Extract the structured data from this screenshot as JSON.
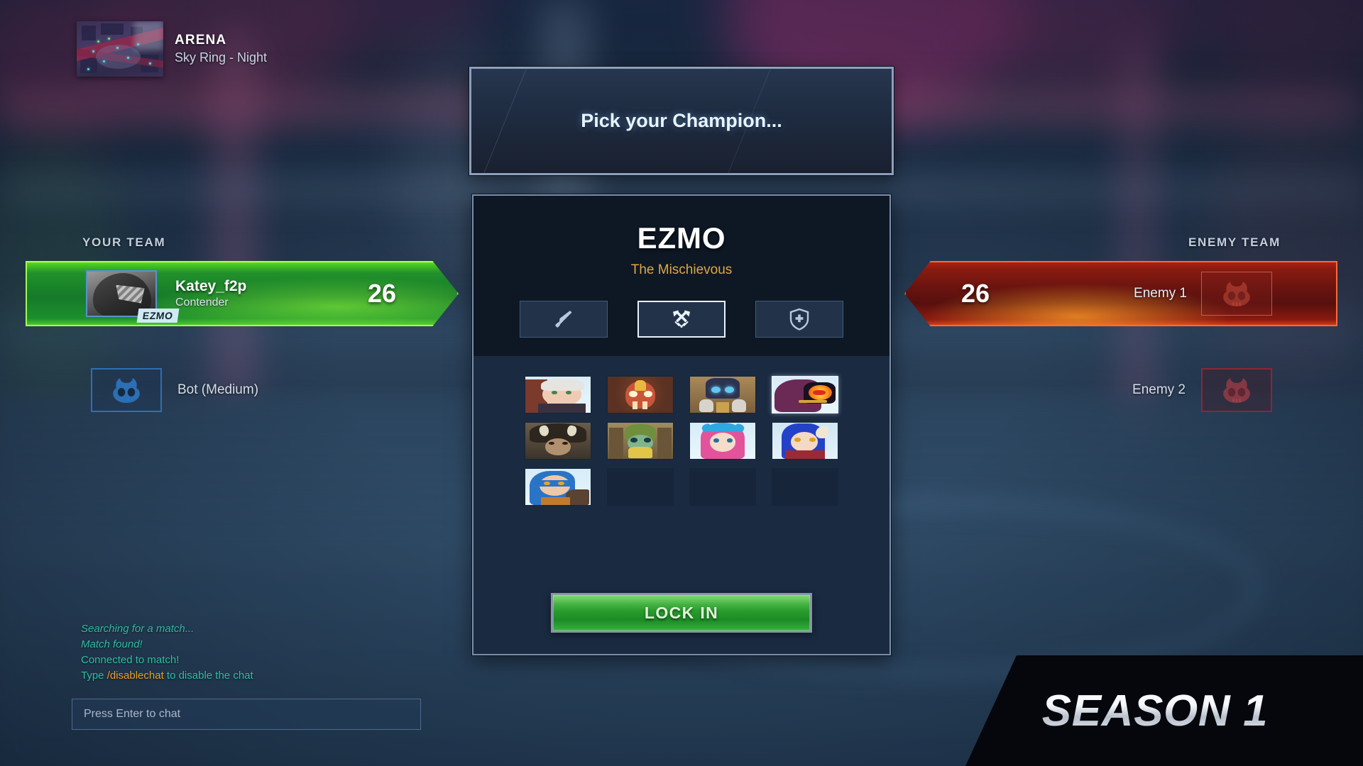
{
  "header": {
    "mode": "ARENA",
    "map_name": "Sky Ring - Night",
    "map_thumb_icon": "map-preview-thumbnail"
  },
  "banner": {
    "pick_prompt": "Pick your Champion..."
  },
  "champion_panel": {
    "name": "EZMO",
    "title": "The Mischievous",
    "roles": [
      {
        "id": "melee",
        "icon": "dagger-icon",
        "label": "Melee",
        "selected": false
      },
      {
        "id": "ranged",
        "icon": "crossed-arrows-icon",
        "label": "Ranged",
        "selected": true
      },
      {
        "id": "support",
        "icon": "shield-cross-icon",
        "label": "Support",
        "selected": false
      }
    ],
    "grid": [
      {
        "id": "c1",
        "name": "White Haired Ranger",
        "selected": false,
        "empty": false
      },
      {
        "id": "c2",
        "name": "Orange Masked Beast",
        "selected": false,
        "empty": false
      },
      {
        "id": "c3",
        "name": "Armored Brute",
        "selected": false,
        "empty": false
      },
      {
        "id": "c4",
        "name": "EZMO",
        "selected": true,
        "empty": false
      },
      {
        "id": "c5",
        "name": "Fur Cloaked Hunter",
        "selected": false,
        "empty": false
      },
      {
        "id": "c6",
        "name": "Green Hooded Gremlin",
        "selected": false,
        "empty": false
      },
      {
        "id": "c7",
        "name": "Pink Haired Priestess",
        "selected": false,
        "empty": false
      },
      {
        "id": "c8",
        "name": "Blue Haired Demoness",
        "selected": false,
        "empty": false
      },
      {
        "id": "c9",
        "name": "Blue Masked Rogue",
        "selected": false,
        "empty": false
      },
      {
        "id": "e1",
        "name": "Empty Slot",
        "selected": false,
        "empty": true
      },
      {
        "id": "e2",
        "name": "Empty Slot",
        "selected": false,
        "empty": true
      },
      {
        "id": "e3",
        "name": "Empty Slot",
        "selected": false,
        "empty": true
      }
    ],
    "lock_in_label": "LOCK IN"
  },
  "your_team": {
    "label": "YOUR TEAM",
    "players": [
      {
        "name": "Katey_f2p",
        "rank": "Contender",
        "score": "26",
        "champion_tag": "EZMO",
        "avatar_icon": "player-avatar",
        "filled": true
      },
      {
        "name": "Bot (Medium)",
        "avatar_icon": "skull-placeholder-icon",
        "filled": false
      }
    ]
  },
  "enemy_team": {
    "label": "ENEMY TEAM",
    "players": [
      {
        "name": "Enemy 1",
        "score": "26",
        "avatar_icon": "skull-placeholder-icon",
        "filled": true
      },
      {
        "name": "Enemy 2",
        "avatar_icon": "skull-placeholder-icon",
        "filled": false
      }
    ]
  },
  "chat": {
    "messages": [
      {
        "text": "Searching for a match...",
        "style": "italic"
      },
      {
        "text": "Match found!",
        "style": "italic"
      },
      {
        "text": "Connected to match!",
        "style": "normal"
      }
    ],
    "hint_prefix": "Type ",
    "hint_command": "/disablechat",
    "hint_suffix": " to disable the chat",
    "input_placeholder": "Press Enter to chat"
  },
  "footer": {
    "season_label": "SEASON 1"
  },
  "colors": {
    "ally_green": "#35b23a",
    "enemy_red": "#b3220f",
    "accent_gold": "#e0a843",
    "chat_teal": "#2fbfa6",
    "panel_bg": "#1a2a40",
    "panel_border": "#7b8ea9"
  }
}
